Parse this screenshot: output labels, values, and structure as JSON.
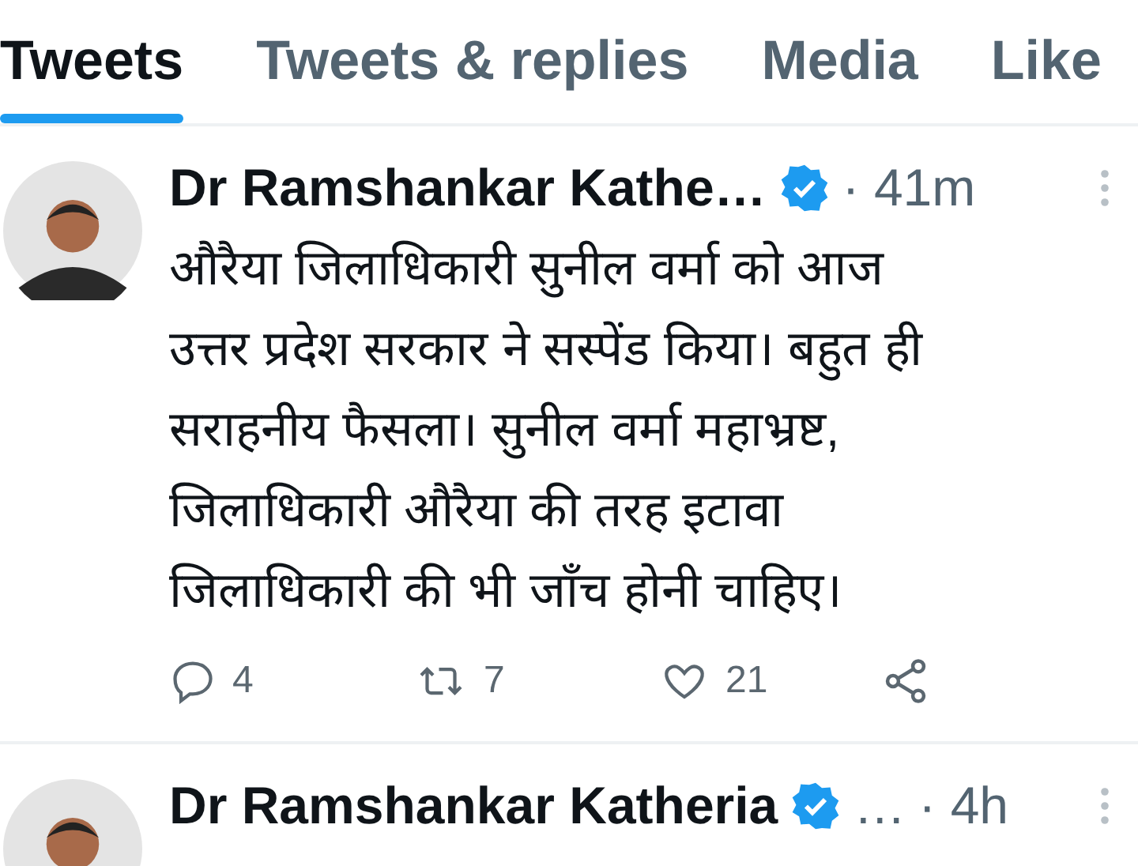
{
  "tabs": [
    {
      "label": "Tweets",
      "selected": true
    },
    {
      "label": "Tweets & replies",
      "selected": false
    },
    {
      "label": "Media",
      "selected": false
    },
    {
      "label": "Like",
      "selected": false
    }
  ],
  "tweets": [
    {
      "name": "Dr Ramshankar Kathe…",
      "verified": true,
      "time": "· 41m",
      "body": [
        "औरैया जिलाधिकारी सुनील वर्मा को आज",
        "उत्तर प्रदेश सरकार ने सस्पेंड किया। बहुत ही",
        "सराहनीय फैसला। सुनील वर्मा महाभ्रष्ट,",
        "जिलाधिकारी औरैया की तरह इटावा",
        "जिलाधिकारी की भी जाँच होनी चाहिए।"
      ],
      "replies": "4",
      "retweets": "7",
      "likes": "21"
    },
    {
      "name": "Dr Ramshankar Katheria",
      "verified": true,
      "extra": "…",
      "time": "· 4h"
    }
  ]
}
